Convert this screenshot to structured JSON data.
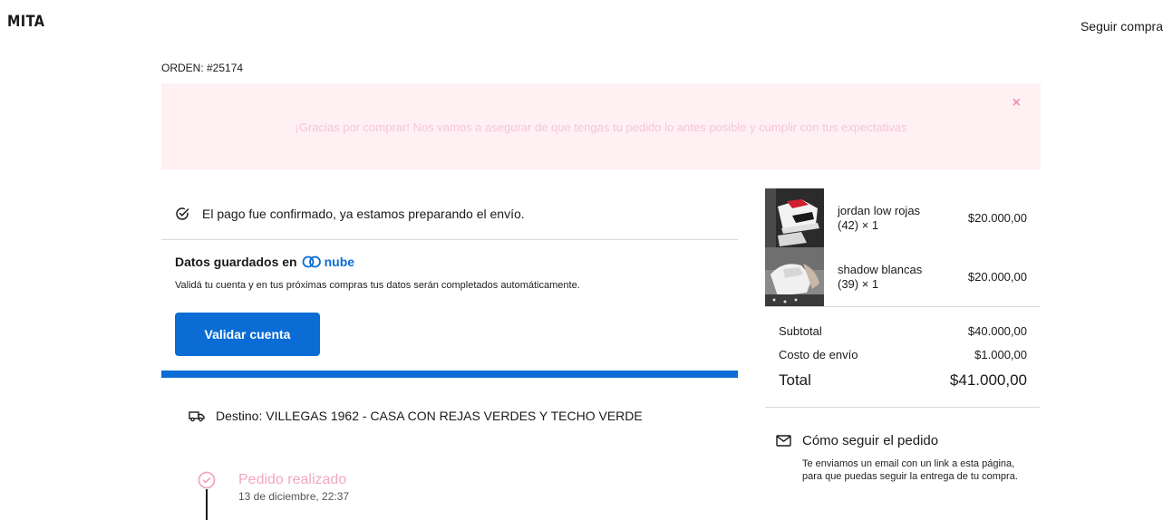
{
  "header": {
    "brand": "MITA",
    "track_link": "Seguir compra"
  },
  "order": {
    "label": "ORDEN: #25174"
  },
  "alert": {
    "message": "¡Gracias por comprar! Nos vamos a asegurar de que tengas tu pedido lo antes posible y cumplir con tus expectativas",
    "close_glyph": "×"
  },
  "payment": {
    "status": "El pago fue confirmado, ya estamos preparando el envío."
  },
  "nube": {
    "title": "Datos guardados en",
    "logo_text": "nube",
    "description": "Validá tu cuenta y en tus próximas compras tus datos serán completados automáticamente.",
    "button_label": "Validar cuenta"
  },
  "shipping": {
    "destination": "Destino: VILLEGAS 1962 - CASA CON REJAS VERDES Y TECHO VERDE"
  },
  "timeline": {
    "steps": [
      {
        "title": "Pedido realizado",
        "date": "13 de diciembre, 22:37"
      }
    ]
  },
  "cart": {
    "items": [
      {
        "name": "jordan low rojas",
        "variant": "(42) × 1",
        "price": "$20.000,00"
      },
      {
        "name": "shadow blancas",
        "variant": "(39) × 1",
        "price": "$20.000,00"
      }
    ],
    "subtotal_label": "Subtotal",
    "subtotal_value": "$40.000,00",
    "shipping_label": "Costo de envío",
    "shipping_value": "$1.000,00",
    "total_label": "Total",
    "total_value": "$41.000,00"
  },
  "follow": {
    "title": "Cómo seguir el pedido",
    "description": "Te enviamos un email con un link a esta página, para que puedas seguir la entrega de tu compra."
  },
  "colors": {
    "accent": "#0a6cd4",
    "alert_bg": "#fff0f4",
    "step_pink": "#f2a7c3"
  }
}
